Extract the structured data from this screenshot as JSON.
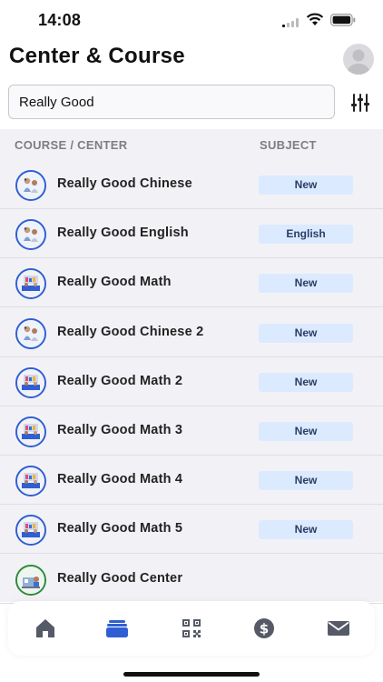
{
  "status": {
    "time": "14:08"
  },
  "header": {
    "title": "Center & Course"
  },
  "search": {
    "value": "Really Good",
    "placeholder": ""
  },
  "columns": {
    "course": "COURSE / CENTER",
    "subject": "SUBJECT"
  },
  "rows": [
    {
      "name": "Really Good Chinese",
      "subject": "New",
      "avatar": "kids-illustration",
      "ring": "#2f5fd3"
    },
    {
      "name": "Really Good English",
      "subject": "English",
      "avatar": "kids-illustration",
      "ring": "#2f5fd3"
    },
    {
      "name": "Really Good Math",
      "subject": "New",
      "avatar": "classroom-illustration",
      "ring": "#2f5fd3"
    },
    {
      "name": "Really Good Chinese 2",
      "subject": "New",
      "avatar": "kids-illustration",
      "ring": "#2f5fd3"
    },
    {
      "name": "Really Good Math 2",
      "subject": "New",
      "avatar": "classroom-illustration",
      "ring": "#2f5fd3"
    },
    {
      "name": "Really Good Math 3",
      "subject": "New",
      "avatar": "classroom-illustration",
      "ring": "#2f5fd3"
    },
    {
      "name": "Really Good Math 4",
      "subject": "New",
      "avatar": "classroom-illustration",
      "ring": "#2f5fd3"
    },
    {
      "name": "Really Good Math 5",
      "subject": "New",
      "avatar": "classroom-illustration",
      "ring": "#2f5fd3"
    },
    {
      "name": "Really Good Center",
      "subject": "",
      "avatar": "center-illustration",
      "ring": "#2e8a3b"
    }
  ],
  "tabs": [
    {
      "icon": "home-icon",
      "active": false
    },
    {
      "icon": "courses-icon",
      "active": true
    },
    {
      "icon": "qr-code-icon",
      "active": false
    },
    {
      "icon": "dollar-icon",
      "active": false
    },
    {
      "icon": "mail-icon",
      "active": false
    }
  ],
  "colors": {
    "accent": "#2f5fd3",
    "badge_bg": "#dceaff",
    "list_bg": "#f2f2f6",
    "icon_gray": "#555a66"
  }
}
